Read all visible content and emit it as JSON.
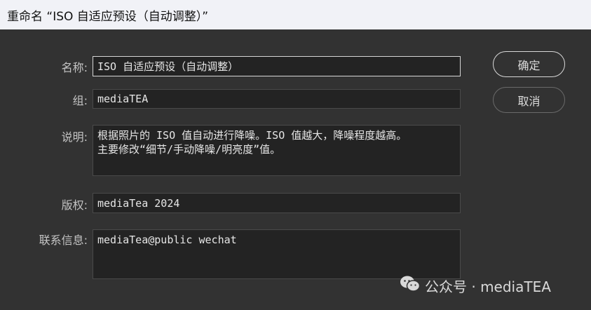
{
  "window": {
    "title": "重命名 “ISO 自适应预设（自动调整）”"
  },
  "form": {
    "name_label": "名称:",
    "name_value": "ISO 自适应预设（自动调整）",
    "group_label": "组:",
    "group_value": "mediaTEA",
    "description_label": "说明:",
    "description_value": "根据照片的 ISO 值自动进行降噪。ISO 值越大，降噪程度越高。\n主要修改“细节/手动降噪/明亮度”值。",
    "copyright_label": "版权:",
    "copyright_value": "mediaTea 2024",
    "contact_label": "联系信息:",
    "contact_value": "mediaTea@public wechat"
  },
  "buttons": {
    "ok_label": "确定",
    "cancel_label": "取消"
  },
  "watermark": {
    "text": "公众号 · mediaTEA",
    "icon": "wechat-icon"
  },
  "colors": {
    "background": "#323232",
    "field_bg": "#232323",
    "titlebar_bg": "#f1f2f7"
  }
}
